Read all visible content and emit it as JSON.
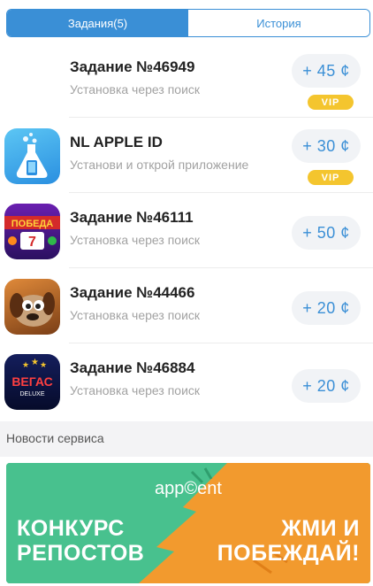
{
  "tabs": [
    {
      "label": "Задания(5)",
      "active": true
    },
    {
      "label": "История",
      "active": false
    }
  ],
  "tasks": [
    {
      "title": "Задание №46949",
      "subtitle": "Установка через поиск",
      "reward": "+ 45 ¢",
      "vip": "VIP",
      "icon": "none"
    },
    {
      "title": "NL APPLE ID",
      "subtitle": "Установи и открой приложение",
      "reward": "+ 30 ¢",
      "vip": "VIP",
      "icon": "bottle-phone-icon"
    },
    {
      "title": "Задание №46111",
      "subtitle": "Установка через поиск",
      "reward": "+ 50 ¢",
      "vip": null,
      "icon": "slots-app-icon",
      "icon_text": "ПОБЕДА"
    },
    {
      "title": "Задание №44466",
      "subtitle": "Установка через поиск",
      "reward": "+ 20 ¢",
      "vip": null,
      "icon": "cartoon-dog-icon"
    },
    {
      "title": "Задание №46884",
      "subtitle": "Установка через поиск",
      "reward": "+ 20 ¢",
      "vip": null,
      "icon": "vegas-deluxe-icon",
      "icon_text": "ВЕГАС",
      "icon_subtext": "DELUXE"
    }
  ],
  "section_title": "Новости сервиса",
  "banner": {
    "logo": "app©ent",
    "left_line1": "КОНКУРС",
    "left_line2": "РЕПОСТОВ",
    "right_line1": "ЖМИ И",
    "right_line2": "ПОБЕЖДАЙ!"
  },
  "colors": {
    "accent": "#3a8fd6",
    "vip": "#f4c52e",
    "banner_green": "#48c18e",
    "banner_orange": "#f29a2e"
  }
}
